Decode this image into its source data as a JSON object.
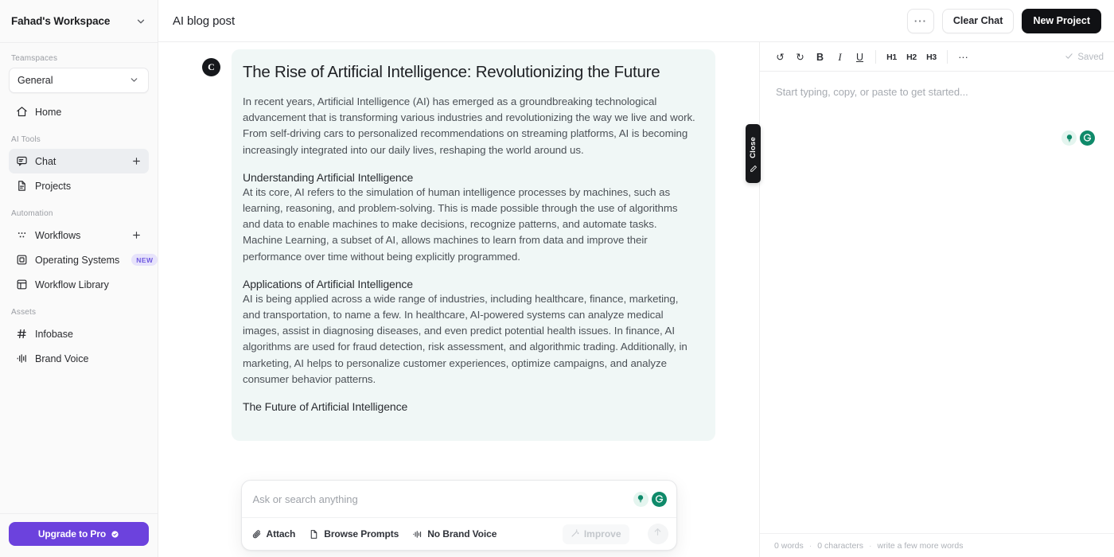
{
  "sidebar": {
    "workspace_name": "Fahad's Workspace",
    "workspace_chevron_icon": "chevron-down-icon",
    "sections": [
      {
        "label": "Teamspaces"
      },
      {
        "label": "AI Tools"
      },
      {
        "label": "Automation"
      },
      {
        "label": "Assets"
      }
    ],
    "teamspace": {
      "selected": "General",
      "chevron_icon": "chevron-down-icon"
    },
    "home": {
      "label": "Home",
      "icon": "home-icon"
    },
    "ai_tools": [
      {
        "label": "Chat",
        "icon": "chat-bubble-icon",
        "active": true,
        "action_icon": "plus-icon"
      },
      {
        "label": "Projects",
        "icon": "document-icon",
        "active": false
      }
    ],
    "automation": [
      {
        "label": "Workflows",
        "icon": "workflow-dots-icon",
        "action_icon": "plus-icon"
      },
      {
        "label": "Operating Systems",
        "icon": "operating-system-icon",
        "badge": "NEW"
      },
      {
        "label": "Workflow Library",
        "icon": "library-grid-icon"
      }
    ],
    "assets": [
      {
        "label": "Infobase",
        "icon": "hash-icon"
      },
      {
        "label": "Brand Voice",
        "icon": "waveform-icon"
      }
    ],
    "upgrade": {
      "label": "Upgrade to Pro",
      "icon": "sparkle-check-icon",
      "color": "#6c42dd"
    }
  },
  "topbar": {
    "doc_title": "AI blog post",
    "more_label": "···",
    "clear_chat_label": "Clear Chat",
    "new_project_label": "New Project"
  },
  "chat": {
    "avatar_initial": "C",
    "message": {
      "title": "The Rise of Artificial Intelligence: Revolutionizing the Future",
      "intro": "In recent years, Artificial Intelligence (AI) has emerged as a groundbreaking technological advancement that is transforming various industries and revolutionizing the way we live and work. From self-driving cars to personalized recommendations on streaming platforms, AI is becoming increasingly integrated into our daily lives, reshaping the world around us.",
      "sections": [
        {
          "heading": "Understanding Artificial Intelligence",
          "body": "At its core, AI refers to the simulation of human intelligence processes by machines, such as learning, reasoning, and problem-solving. This is made possible through the use of algorithms and data to enable machines to make decisions, recognize patterns, and automate tasks. Machine Learning, a subset of AI, allows machines to learn from data and improve their performance over time without being explicitly programmed."
        },
        {
          "heading": "Applications of Artificial Intelligence",
          "body": "AI is being applied across a wide range of industries, including healthcare, finance, marketing, and transportation, to name a few. In healthcare, AI-powered systems can analyze medical images, assist in diagnosing diseases, and even predict potential health issues. In finance, AI algorithms are used for fraud detection, risk assessment, and algorithmic trading. Additionally, in marketing, AI helps to personalize customer experiences, optimize campaigns, and analyze consumer behavior patterns."
        },
        {
          "heading": "The Future of Artificial Intelligence",
          "body": ""
        }
      ]
    }
  },
  "composer": {
    "placeholder": "Ask or search anything",
    "bulb_icon": "lightbulb-icon",
    "grammarly_icon": "grammarly-icon",
    "attach_label": "Attach",
    "attach_icon": "paperclip-icon",
    "browse_prompts_label": "Browse Prompts",
    "browse_prompts_icon": "document-icon",
    "brand_voice_label": "No Brand Voice",
    "brand_voice_icon": "waveform-icon",
    "improve_label": "Improve",
    "improve_icon": "magic-wand-icon",
    "send_icon": "send-arrow-icon"
  },
  "close_tab": {
    "label": "Close",
    "icon": "pencil-icon"
  },
  "editor": {
    "toolbar": [
      {
        "name": "undo",
        "glyph": "↺",
        "type": "icon"
      },
      {
        "name": "redo",
        "glyph": "↻",
        "type": "icon"
      },
      {
        "name": "bold",
        "glyph": "B",
        "type": "bold"
      },
      {
        "name": "italic",
        "glyph": "I",
        "type": "italic"
      },
      {
        "name": "underline",
        "glyph": "U",
        "type": "underline"
      },
      {
        "name": "heading-1",
        "glyph": "H1",
        "type": "heading"
      },
      {
        "name": "heading-2",
        "glyph": "H2",
        "type": "heading"
      },
      {
        "name": "heading-3",
        "glyph": "H3",
        "type": "heading"
      },
      {
        "name": "more",
        "glyph": "···",
        "type": "icon"
      }
    ],
    "saved_label": "Saved",
    "saved_icon": "check-icon",
    "placeholder": "Start typing, copy, or paste to get started...",
    "bulb_icon": "lightbulb-icon",
    "grammarly_icon": "grammarly-icon",
    "status": {
      "words": "0 words",
      "characters": "0 characters",
      "hint": "write a few more words"
    }
  },
  "colors": {
    "accent_purple": "#6c42dd",
    "dark_button": "#101114",
    "bubble_bg": "#f0f7f6",
    "green": "#0f8a6a",
    "badge_new_bg": "#e7e3fb",
    "badge_new_text": "#6f5ae0"
  }
}
